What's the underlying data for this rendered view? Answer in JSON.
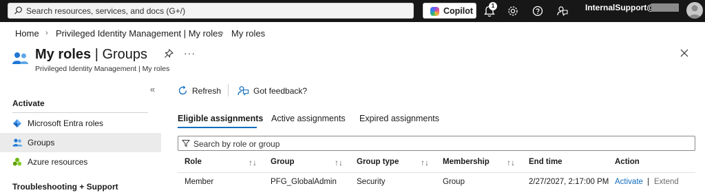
{
  "topbar": {
    "search_placeholder": "Search resources, services, and docs (G+/)",
    "copilot_label": "Copilot",
    "notification_count": "1",
    "user": "InternalSupport@"
  },
  "breadcrumb": [
    "Home",
    "Privileged Identity Management | My roles",
    "My roles"
  ],
  "header": {
    "title_bold": "My roles",
    "title_rest": " | Groups",
    "subtitle": "Privileged Identity Management | My roles",
    "more": "···"
  },
  "sidebar": {
    "collapse": "«",
    "section1": "Activate",
    "items": [
      {
        "label": "Microsoft Entra roles"
      },
      {
        "label": "Groups"
      },
      {
        "label": "Azure resources"
      }
    ],
    "section2": "Troubleshooting + Support"
  },
  "commands": {
    "refresh": "Refresh",
    "feedback": "Got feedback?"
  },
  "tabs": [
    "Eligible assignments",
    "Active assignments",
    "Expired assignments"
  ],
  "filter_placeholder": "Search by role or group",
  "table": {
    "columns": [
      "Role",
      "Group",
      "Group type",
      "Membership",
      "End time",
      "Action"
    ],
    "sort_icon": "↑↓",
    "rows": [
      {
        "role": "Member",
        "group": "PFG_GlobalAdmin",
        "group_type": "Security",
        "membership": "Group",
        "end_time": "2/27/2027, 2:17:00 PM",
        "action_primary": "Activate",
        "action_sep": "|",
        "action_secondary": "Extend"
      }
    ]
  },
  "colors": {
    "topbar": "#171717",
    "accent": "#0f6cbd",
    "selected_nav": "#ebebeb"
  }
}
